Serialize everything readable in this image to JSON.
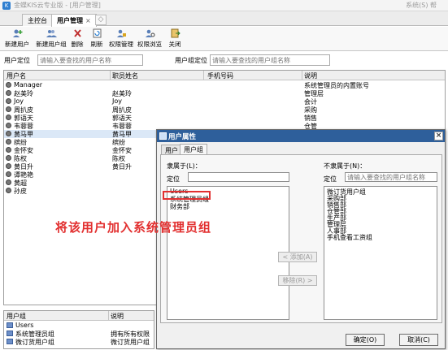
{
  "window": {
    "title": "金蝶KIS云专业版 - [用户管理]",
    "system_menu": "系统(S) 帮"
  },
  "tabs": [
    {
      "label": "主控台"
    },
    {
      "label": "用户管理",
      "close": "×"
    }
  ],
  "toolbar": [
    {
      "label": "新建用户",
      "icon": "new-user-icon"
    },
    {
      "label": "新建用户组",
      "icon": "new-group-icon"
    },
    {
      "label": "删除",
      "icon": "delete-icon"
    },
    {
      "label": "刷新",
      "icon": "refresh-icon"
    },
    {
      "label": "权限管理",
      "icon": "permission-manage-icon"
    },
    {
      "label": "权限浏览",
      "icon": "permission-browse-icon"
    },
    {
      "label": "关闭",
      "icon": "close-icon"
    }
  ],
  "locate": {
    "user_label": "用户定位",
    "user_placeholder": "请输入要查找的用户名称",
    "group_label": "用户组定位",
    "group_placeholder": "请输入要查找的用户组名称"
  },
  "user_grid": {
    "headers": [
      "用户名",
      "职员姓名",
      "手机号码",
      "说明"
    ],
    "rows": [
      [
        "Manager",
        "",
        "",
        "系统管理员的内置账号"
      ],
      [
        "赵美玲",
        "赵美玲",
        "",
        "管理层"
      ],
      [
        "Joy",
        "Joy",
        "",
        "会计"
      ],
      [
        "周扒皮",
        "周扒皮",
        "",
        "采购"
      ],
      [
        "郭语天",
        "郭语天",
        "",
        "销售"
      ],
      [
        "韦蓉蓉",
        "韦蓉蓉",
        "",
        "仓管"
      ],
      [
        "黄马甲",
        "黄马甲",
        "",
        ""
      ],
      [
        "缤纷",
        "缤纷",
        "",
        ""
      ],
      [
        "金怀安",
        "金怀安",
        "",
        ""
      ],
      [
        "陈权",
        "陈权",
        "",
        ""
      ],
      [
        "黄日升",
        "黄日升",
        "",
        ""
      ],
      [
        "谭艳艳",
        "",
        "",
        ""
      ],
      [
        "黄超",
        "",
        "",
        ""
      ],
      [
        "孙皮",
        "",
        "",
        ""
      ]
    ],
    "selected_index": 6
  },
  "group_grid": {
    "headers": [
      "用户组",
      "说明"
    ],
    "rows": [
      [
        "Users",
        ""
      ],
      [
        "系统管理员组",
        "拥有所有权限"
      ],
      [
        "微订货用户组",
        "微订货用户组"
      ]
    ]
  },
  "dialog": {
    "title": "用户属性",
    "tabs": [
      "用户",
      "用户组"
    ],
    "active_tab": 1,
    "member_of_label": "隶属于(L)：",
    "not_member_label": "不隶属于(N)：",
    "locate_label": "定位",
    "locate_value": "",
    "right_locate_placeholder": "请输入要查找的用户组名称",
    "member_of": [
      "Users",
      "系统管理员组",
      "财务部"
    ],
    "not_member_of": [
      "微订货用户组",
      "采购部",
      "销售部",
      "仓管部",
      "生产部",
      "管理层",
      "人事部",
      "手机查看工资组"
    ],
    "add_button": "< 添加(A)",
    "remove_button": "移除(R) >",
    "ok_button": "确定(O)",
    "cancel_button": "取消(C)"
  },
  "annotation": {
    "text": "将该用户加入系统管理员组",
    "color": "#e23030"
  }
}
